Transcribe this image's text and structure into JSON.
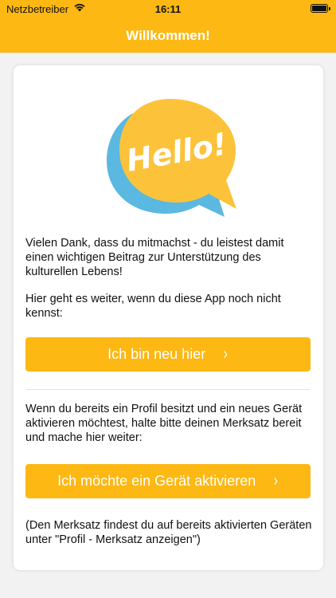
{
  "status_bar": {
    "carrier": "Netzbetreiber",
    "time": "16:11",
    "icons": [
      "wifi-icon",
      "battery-icon"
    ]
  },
  "nav": {
    "title": "Willkommen!"
  },
  "card": {
    "hello_text": "Hello!",
    "intro": "Vielen Dank, dass du mitmachst - du leistest damit einen wichtigen Beitrag zur Unterstützung des kulturellen Lebens!",
    "new_hint": "Hier geht es weiter, wenn du diese App noch nicht kennst:",
    "btn_new": "Ich bin neu hier",
    "existing_hint": "Wenn du bereits ein Profil besitzt und ein neues Gerät aktivieren möchtest, halte bitte deinen Merksatz bereit und mache hier weiter:",
    "btn_activate": "Ich möchte ein Gerät aktivieren",
    "footnote": "(Den Merksatz findest du auf bereits aktivierten Geräten unter \"Profil - Merksatz anzeigen\")",
    "chevron": "›"
  },
  "colors": {
    "accent": "#fdb813",
    "bubble_yellow": "#fcc33a",
    "bubble_shadow": "#5bb8e0"
  }
}
